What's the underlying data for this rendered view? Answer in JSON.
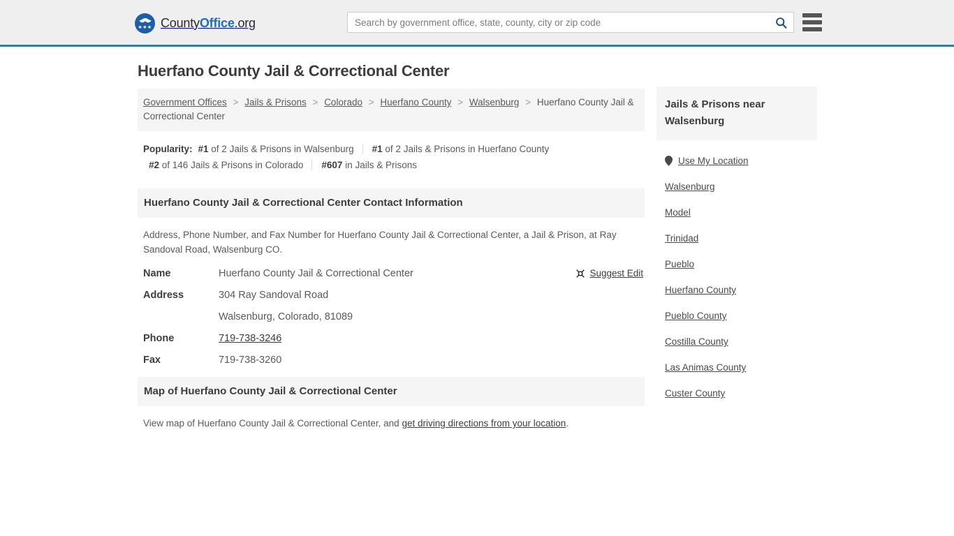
{
  "header": {
    "logo": {
      "county": "County",
      "office": "Office",
      "org": ".org",
      "stars": "★★★"
    },
    "search": {
      "placeholder": "Search by government office, state, county, city or zip code",
      "value": "",
      "icon": "search-icon"
    },
    "menu_icon": "hamburger-menu-icon",
    "accent_color": "#3a7ca5"
  },
  "main": {
    "title": "Huerfano County Jail & Correctional Center",
    "breadcrumb": {
      "separator": ">",
      "items": [
        "Government Offices",
        "Jails & Prisons",
        "Colorado",
        "Huerfano County",
        "Walsenburg",
        "Huerfano County Jail & Correctional Center"
      ]
    },
    "popularity": {
      "label": "Popularity:",
      "items": [
        {
          "rank": "#1",
          "text": " of 2 Jails & Prisons in Walsenburg"
        },
        {
          "rank": "#1",
          "text": " of 2 Jails & Prisons in Huerfano County"
        },
        {
          "rank": "#2",
          "text": " of 146 Jails & Prisons in Colorado"
        },
        {
          "rank": "#607",
          "text": " in Jails & Prisons"
        }
      ]
    },
    "contact_section": {
      "heading": "Huerfano County Jail & Correctional Center Contact Information",
      "description": "Address, Phone Number, and Fax Number for Huerfano County Jail & Correctional Center, a Jail & Prison, at Ray Sandoval Road, Walsenburg CO.",
      "suggest_edit": {
        "label": "Suggest Edit",
        "icon": "suggest-edit-icon"
      },
      "rows": [
        {
          "label": "Name",
          "value": "Huerfano County Jail & Correctional Center",
          "link": false
        },
        {
          "label": "Address",
          "value": "304 Ray Sandoval Road",
          "link": false
        },
        {
          "label": "",
          "value": "Walsenburg, Colorado, 81089",
          "link": false
        },
        {
          "label": "Phone",
          "value": "719-738-3246",
          "link": true
        },
        {
          "label": "Fax",
          "value": "719-738-3260",
          "link": false
        }
      ]
    },
    "map_section": {
      "heading": "Map of Huerfano County Jail & Correctional Center",
      "text_before": "View map of Huerfano County Jail & Correctional Center, and ",
      "link": "get driving directions from your location",
      "text_after": "."
    }
  },
  "sidebar": {
    "heading": "Jails & Prisons near Walsenburg",
    "use_my_location": {
      "label": "Use My Location",
      "icon": "map-pin-icon"
    },
    "links": [
      "Walsenburg",
      "Model",
      "Trinidad",
      "Pueblo",
      "Huerfano County",
      "Pueblo County",
      "Costilla County",
      "Las Animas County",
      "Custer County"
    ]
  }
}
